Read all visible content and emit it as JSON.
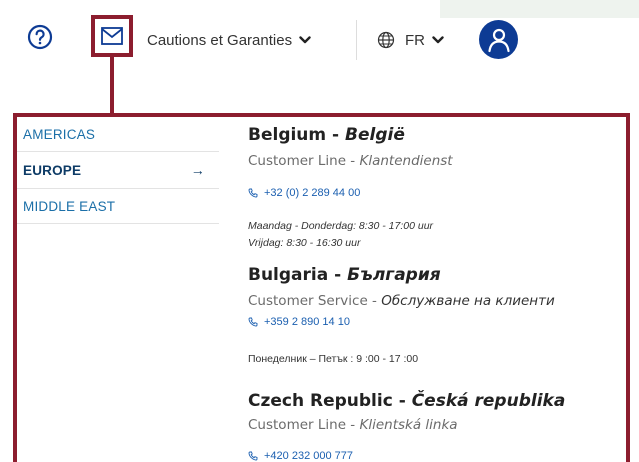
{
  "header": {
    "help_icon": "question-circle-icon",
    "mail_icon": "envelope-icon",
    "cautions_label": "Cautions et Garanties",
    "language_label": "FR",
    "avatar_icon": "user-icon"
  },
  "colors": {
    "highlight": "#8c1d2e",
    "avatar": "#0d3b94",
    "link": "#1b6fa8",
    "active_region": "#0d3b66"
  },
  "regions": [
    {
      "label": "AMERICAS",
      "active": false
    },
    {
      "label": "EUROPE",
      "active": true
    },
    {
      "label": "MIDDLE EAST",
      "active": false
    }
  ],
  "active_arrow": "→",
  "countries": [
    {
      "name": "Belgium",
      "separator": " - ",
      "local_name": "België",
      "line_label": "Customer Line",
      "line_sep": " - ",
      "line_local": "Klantendienst",
      "phone": "+32 (0) 2 289 44 00",
      "hours": [
        "Maandag - Donderdag: 8:30 - 17:00 uur",
        "Vrijdag: 8:30 - 16:30 uur"
      ]
    },
    {
      "name": "Bulgaria",
      "separator": " - ",
      "local_name": "България",
      "line_label": "Customer Service",
      "line_sep": " - ",
      "line_local": "Обслужване на клиенти",
      "phone": "+359 2 890 14 10",
      "hours": [
        "Понеделник – Петък : 9 :00 - 17 :00"
      ]
    },
    {
      "name": "Czech Republic",
      "separator": " - ",
      "local_name": "Česká republika",
      "line_label": "Customer Line",
      "line_sep": " - ",
      "line_local": "Klientská linka",
      "phone": "+420 232 000 777",
      "hours": []
    }
  ]
}
